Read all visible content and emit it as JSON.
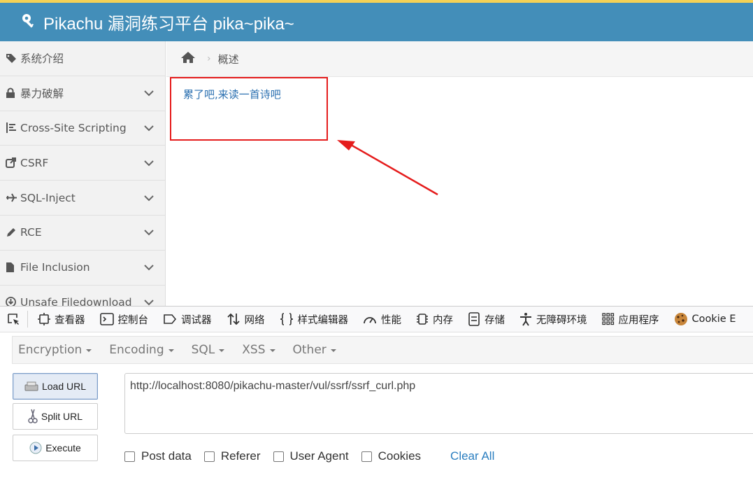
{
  "app": {
    "title": "Pikachu 漏洞练习平台 pika~pika~"
  },
  "sidebar": {
    "items": [
      {
        "label": "系统介绍",
        "icon": "tag-icon",
        "expandable": false
      },
      {
        "label": "暴力破解",
        "icon": "lock-icon",
        "expandable": true
      },
      {
        "label": "Cross-Site Scripting",
        "icon": "list-icon",
        "expandable": true
      },
      {
        "label": "CSRF",
        "icon": "share-icon",
        "expandable": true
      },
      {
        "label": "SQL-Inject",
        "icon": "plane-icon",
        "expandable": true
      },
      {
        "label": "RCE",
        "icon": "pencil-icon",
        "expandable": true
      },
      {
        "label": "File Inclusion",
        "icon": "file-icon",
        "expandable": true
      },
      {
        "label": "Unsafe Filedownload",
        "icon": "download-icon",
        "expandable": true
      }
    ]
  },
  "breadcrumb": {
    "current": "概述"
  },
  "content": {
    "poem_text": "累了吧,来读一首诗吧"
  },
  "annotation": {
    "box_color": "#e51c1c",
    "arrow_color": "#e51c1c"
  },
  "devtools": {
    "tools": [
      {
        "label": "查看器",
        "icon": "inspector-icon"
      },
      {
        "label": "控制台",
        "icon": "console-icon"
      },
      {
        "label": "调试器",
        "icon": "debugger-icon"
      },
      {
        "label": "网络",
        "icon": "network-icon"
      },
      {
        "label": "样式编辑器",
        "icon": "style-editor-icon"
      },
      {
        "label": "性能",
        "icon": "performance-icon"
      },
      {
        "label": "内存",
        "icon": "memory-icon"
      },
      {
        "label": "存储",
        "icon": "storage-icon"
      },
      {
        "label": "无障碍环境",
        "icon": "accessibility-icon"
      },
      {
        "label": "应用程序",
        "icon": "application-icon"
      },
      {
        "label": "Cookie E",
        "icon": "cookie-icon"
      }
    ]
  },
  "hackbar": {
    "menus": [
      "Encryption",
      "Encoding",
      "SQL",
      "XSS",
      "Other"
    ],
    "buttons": {
      "load": "Load URL",
      "split": "Split URL",
      "execute": "Execute"
    },
    "url_value": "http://localhost:8080/pikachu-master/vul/ssrf/ssrf_curl.php",
    "options": [
      "Post data",
      "Referer",
      "User Agent",
      "Cookies"
    ],
    "clear_all": "Clear All"
  },
  "colors": {
    "header": "#438eb9",
    "accent_top": "#f5d155",
    "link": "#2a7ec0"
  }
}
